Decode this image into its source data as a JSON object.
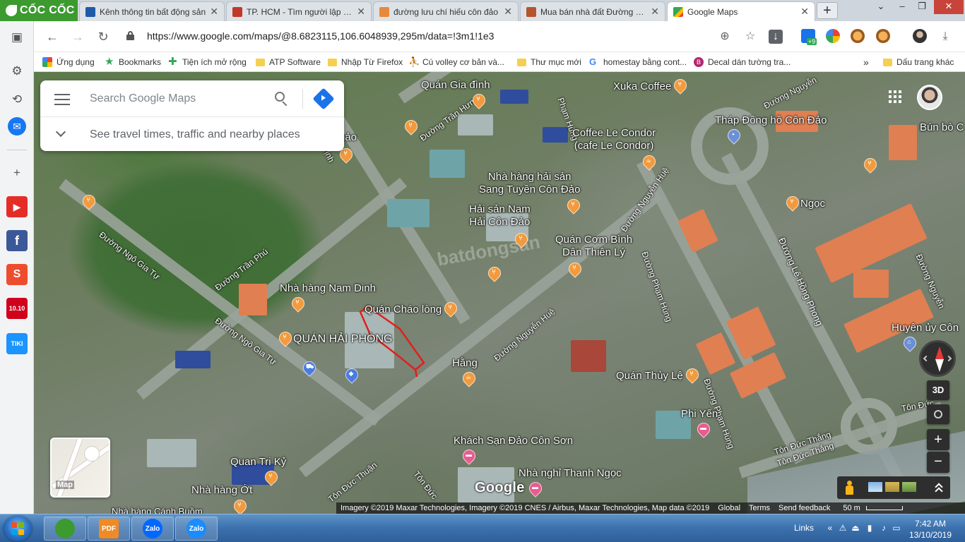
{
  "browser": {
    "brand": "CỐC CỐC",
    "tabs": [
      {
        "label": "Kênh thông tin bất động sản",
        "color": "#1e5aa8",
        "active": false
      },
      {
        "label": "TP. HCM - Tìm người lập nhóm",
        "color": "#c0392b",
        "active": false
      },
      {
        "label": "đường lưu chí hiếu côn đảo",
        "color": "#e8893a",
        "active": false
      },
      {
        "label": "Mua bán nhà đất Đường Lưu",
        "color": "#b5552b",
        "active": false
      },
      {
        "label": "Google Maps",
        "color": "#34a853",
        "active": true
      }
    ],
    "window_controls": {
      "minimize": "–",
      "restore": "❐",
      "close": "✕"
    },
    "address": {
      "url": "https://www.google.com/maps/@8.6823115,106.6048939,295m/data=!3m1!1e3",
      "extension_badge": "+9"
    },
    "bookmarks": [
      {
        "label": "Ứng dụng",
        "icon": "apps-grid-icon",
        "color": "#e0492d"
      },
      {
        "label": "Bookmarks",
        "icon": "star-icon",
        "color": "#34a853"
      },
      {
        "label": "Tiện ích mở rộng",
        "icon": "puzzle-icon",
        "color": "#34a853"
      },
      {
        "label": "ATP Software",
        "icon": "folder-icon",
        "color": "#f5cf4f"
      },
      {
        "label": "Nhập Từ Firefox",
        "icon": "folder-icon",
        "color": "#f5cf4f"
      },
      {
        "label": "Cú volley cơ bản và...",
        "icon": "player-icon",
        "color": "#333333"
      },
      {
        "label": "Thư mục mới",
        "icon": "folder-icon",
        "color": "#f5cf4f"
      },
      {
        "label": "homestay bằng cont...",
        "icon": "google-g-icon",
        "color": "#4285f4"
      },
      {
        "label": "Decal dán tường tra...",
        "icon": "b-circle-icon",
        "color": "#b1286b"
      }
    ],
    "bookmarks_overflow": "»",
    "other_bookmarks": "Dấu trang khác"
  },
  "sidebar": {
    "items": [
      {
        "name": "gear-icon",
        "glyph": "⚙",
        "color": "#f2f3f5"
      },
      {
        "name": "history-icon",
        "glyph": "⟲",
        "color": "#f2f3f5"
      },
      {
        "name": "messenger-icon",
        "glyph": "✉",
        "color": "#1877f2"
      },
      {
        "name": "add-icon",
        "glyph": "+",
        "color": "#f2f3f5"
      },
      {
        "name": "youtube-icon",
        "glyph": "▶",
        "color": "#e52d27"
      },
      {
        "name": "facebook-icon",
        "glyph": "f",
        "color": "#3b5998"
      },
      {
        "name": "shopee-icon",
        "glyph": "S",
        "color": "#ee4d2d"
      },
      {
        "name": "sale-1010-icon",
        "glyph": "10.10",
        "color": "#d0011b"
      },
      {
        "name": "tiki-icon",
        "glyph": "TIKI",
        "color": "#1a94ff"
      }
    ]
  },
  "maps": {
    "search_placeholder": "Search Google Maps",
    "travel_hint": "See travel times, traffic and nearby places",
    "layer_label": "Map",
    "controls": {
      "tilt": "3D",
      "zoom_in": "+",
      "zoom_out": "−"
    },
    "logo": "Google",
    "attribution": "Imagery ©2019 Maxar Technologies, Imagery ©2019 CNES / Airbus, Maxar Technologies, Map data ©2019",
    "footer_links": [
      "Global",
      "Terms",
      "Send feedback"
    ],
    "scale": "50 m",
    "places": [
      {
        "name": "Quán Gia đình",
        "icon": "restaurant-icon"
      },
      {
        "name": "Xuka Coffee",
        "icon": "restaurant-icon"
      },
      {
        "name": "Tháp Đồng hồ Côn Đảo",
        "icon": "landmark-icon"
      },
      {
        "name": "Bún bò C",
        "icon": ""
      },
      {
        "name": "Coffee Le Condor\n(cafe Le Condor)",
        "icon": "cafe-icon"
      },
      {
        "name": "Nhà hàng hải sản\nSang Tuyền Côn Đảo",
        "icon": "restaurant-icon"
      },
      {
        "name": "Hải sản Nam\nHải Côn Đảo",
        "icon": "restaurant-icon"
      },
      {
        "name": "Quán Cơm Bình\nDân Thiên Lý",
        "icon": "restaurant-icon"
      },
      {
        "name": "Ngọc",
        "icon": "restaurant-icon"
      },
      {
        "name": "Nhà hàng Nam Dinh",
        "icon": "restaurant-icon"
      },
      {
        "name": "Quán Cháo lòng",
        "icon": "restaurant-icon"
      },
      {
        "name": "QUÁN HẢI PHÒNG",
        "icon": "restaurant-icon"
      },
      {
        "name": "Hằng",
        "icon": "cafe-icon"
      },
      {
        "name": "Quán Thủy Lệ",
        "icon": "restaurant-icon"
      },
      {
        "name": "Phi Yến",
        "icon": "hotel-icon"
      },
      {
        "name": "Khách Sạn Đảo Côn Sơn",
        "icon": "hotel-icon"
      },
      {
        "name": "Nhà nghỉ Thanh Ngọc",
        "icon": "hotel-icon"
      },
      {
        "name": "Quan Tri Kỷ",
        "icon": "restaurant-icon"
      },
      {
        "name": "Nhà hàng Ớt",
        "icon": "restaurant-icon"
      },
      {
        "name": "Huyện ủy Côn",
        "icon": "government-icon"
      },
      {
        "name": "Nhà hàng Cánh Buồm",
        "icon": "restaurant-icon"
      },
      {
        "name": "hảo",
        "icon": "restaurant-icon"
      }
    ],
    "streets": [
      "Đường Trần Phú",
      "Đường Ngô Gia Tự",
      "Đường Ngô Gia Tự",
      "Trịnh",
      "Đường Trần Hưng",
      "Phạm Hùng",
      "Đường Nguyễn Huệ",
      "Đường Nguyễn Huệ",
      "Đường Phạm Hùng",
      "Đường Phạm Hùng",
      "Đường Lê Hồng Phong",
      "Đường Nguyễn",
      "Đường Nguyễn",
      "Tôn Đức Thắng",
      "Tôn Đức Thắng",
      "Tôn Đức",
      "Tôn Đức",
      "Tôn Đức Thuận"
    ],
    "watermark": "batdongsan"
  },
  "taskbar": {
    "apps": [
      {
        "name": "coccoc-taskbar-icon",
        "label": "",
        "color": "#3c9a2f"
      },
      {
        "name": "pdf-taskbar-icon",
        "label": "PDF",
        "color": "#f08a24"
      },
      {
        "name": "zalo-taskbar-icon",
        "label": "Zalo",
        "color": "#0068ff"
      },
      {
        "name": "zalo2-taskbar-icon",
        "label": "Zalo",
        "color": "#1a8cff"
      }
    ],
    "links": "Links",
    "time": "7:42 AM",
    "date": "13/10/2019"
  }
}
